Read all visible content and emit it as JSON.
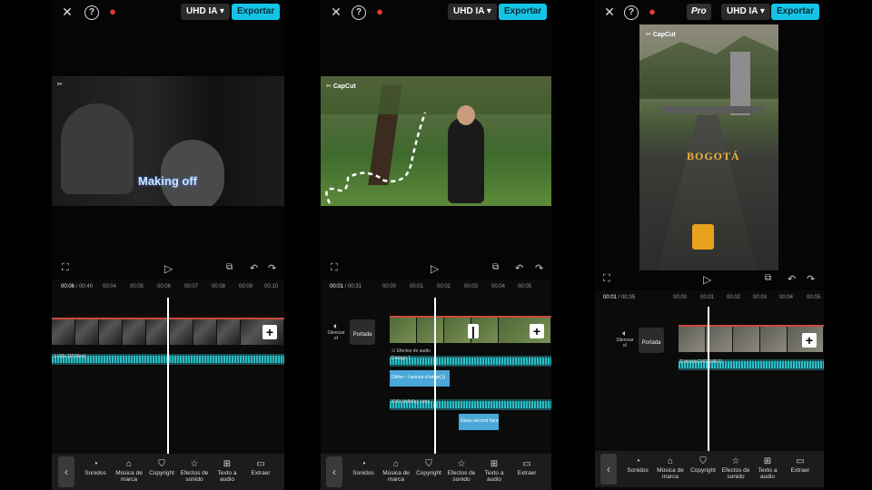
{
  "top": {
    "quality_label": "UHD IA",
    "export_label": "Exportar",
    "pro_label": "Pro"
  },
  "brand": "CapCut",
  "panel1": {
    "overlay_text": "Making off",
    "time_current": "00:06",
    "time_total": "00:40",
    "ticks": [
      "00:04",
      "00:05",
      "00:06",
      "00:07",
      "00:08",
      "00:09",
      "00:10"
    ],
    "audio_label": "1+0(b-11016ea)"
  },
  "panel2": {
    "time_current": "00:01",
    "time_total": "00:31",
    "ticks": [
      "00:00",
      "00:01",
      "00:02",
      "00:03",
      "00:04",
      "00:05"
    ],
    "mute_label": "Silenciar el",
    "cover_label": "Portada",
    "effect_label": "Efectos de audio",
    "audio1_label": "Dialogo 1",
    "text_clip1": "Glitter - I wanna change(1)",
    "audio2_label": "Kid's birthday song",
    "text_clip2": "Glass second hand"
  },
  "panel3": {
    "city_text": "BOGOTÁ",
    "time_current": "00:01",
    "time_total": "00:35",
    "ticks": [
      "00:00",
      "00:01",
      "00:02",
      "00:03",
      "00:04",
      "00:05"
    ],
    "mute_label": "Silenciar el",
    "cover_label": "Portada",
    "audio_label": "Extraído(2402048-0)"
  },
  "toolbar": {
    "items": [
      {
        "label": "Sonidos",
        "icon": "sound-icon"
      },
      {
        "label": "Música de marca",
        "icon": "brand-music-icon"
      },
      {
        "label": "Copyright",
        "icon": "copyright-shield-icon"
      },
      {
        "label": "Efectos de sonido",
        "icon": "sound-effect-icon"
      },
      {
        "label": "Texto a audio",
        "icon": "text-to-audio-icon"
      },
      {
        "label": "Extraer",
        "icon": "extract-folder-icon"
      }
    ]
  },
  "colors": {
    "accent": "#13c4e6",
    "audio_wave": "#26c0c8",
    "text_clip": "#4aa8d8",
    "flame": "#e73b2c"
  }
}
